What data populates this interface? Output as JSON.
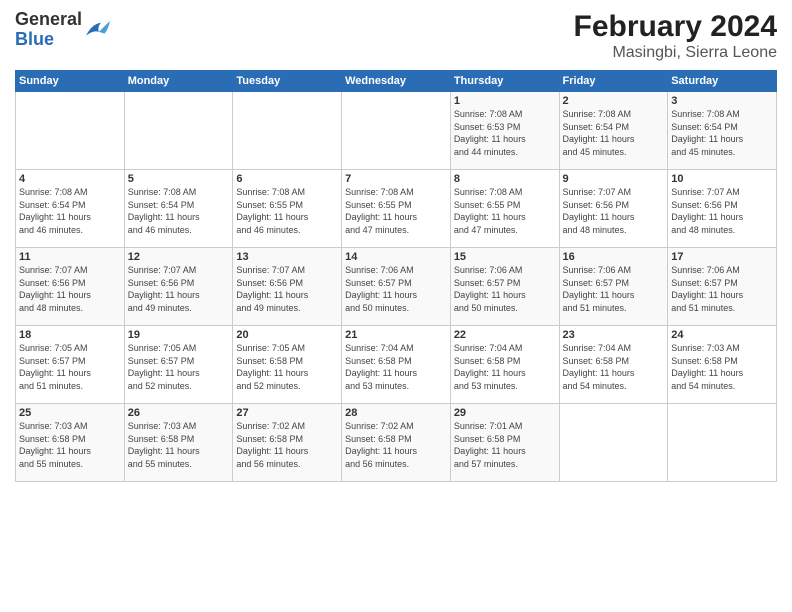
{
  "logo": {
    "general": "General",
    "blue": "Blue"
  },
  "title": "February 2024",
  "subtitle": "Masingbi, Sierra Leone",
  "headers": [
    "Sunday",
    "Monday",
    "Tuesday",
    "Wednesday",
    "Thursday",
    "Friday",
    "Saturday"
  ],
  "weeks": [
    [
      {
        "day": "",
        "info": ""
      },
      {
        "day": "",
        "info": ""
      },
      {
        "day": "",
        "info": ""
      },
      {
        "day": "",
        "info": ""
      },
      {
        "day": "1",
        "info": "Sunrise: 7:08 AM\nSunset: 6:53 PM\nDaylight: 11 hours\nand 44 minutes."
      },
      {
        "day": "2",
        "info": "Sunrise: 7:08 AM\nSunset: 6:54 PM\nDaylight: 11 hours\nand 45 minutes."
      },
      {
        "day": "3",
        "info": "Sunrise: 7:08 AM\nSunset: 6:54 PM\nDaylight: 11 hours\nand 45 minutes."
      }
    ],
    [
      {
        "day": "4",
        "info": "Sunrise: 7:08 AM\nSunset: 6:54 PM\nDaylight: 11 hours\nand 46 minutes."
      },
      {
        "day": "5",
        "info": "Sunrise: 7:08 AM\nSunset: 6:54 PM\nDaylight: 11 hours\nand 46 minutes."
      },
      {
        "day": "6",
        "info": "Sunrise: 7:08 AM\nSunset: 6:55 PM\nDaylight: 11 hours\nand 46 minutes."
      },
      {
        "day": "7",
        "info": "Sunrise: 7:08 AM\nSunset: 6:55 PM\nDaylight: 11 hours\nand 47 minutes."
      },
      {
        "day": "8",
        "info": "Sunrise: 7:08 AM\nSunset: 6:55 PM\nDaylight: 11 hours\nand 47 minutes."
      },
      {
        "day": "9",
        "info": "Sunrise: 7:07 AM\nSunset: 6:56 PM\nDaylight: 11 hours\nand 48 minutes."
      },
      {
        "day": "10",
        "info": "Sunrise: 7:07 AM\nSunset: 6:56 PM\nDaylight: 11 hours\nand 48 minutes."
      }
    ],
    [
      {
        "day": "11",
        "info": "Sunrise: 7:07 AM\nSunset: 6:56 PM\nDaylight: 11 hours\nand 48 minutes."
      },
      {
        "day": "12",
        "info": "Sunrise: 7:07 AM\nSunset: 6:56 PM\nDaylight: 11 hours\nand 49 minutes."
      },
      {
        "day": "13",
        "info": "Sunrise: 7:07 AM\nSunset: 6:56 PM\nDaylight: 11 hours\nand 49 minutes."
      },
      {
        "day": "14",
        "info": "Sunrise: 7:06 AM\nSunset: 6:57 PM\nDaylight: 11 hours\nand 50 minutes."
      },
      {
        "day": "15",
        "info": "Sunrise: 7:06 AM\nSunset: 6:57 PM\nDaylight: 11 hours\nand 50 minutes."
      },
      {
        "day": "16",
        "info": "Sunrise: 7:06 AM\nSunset: 6:57 PM\nDaylight: 11 hours\nand 51 minutes."
      },
      {
        "day": "17",
        "info": "Sunrise: 7:06 AM\nSunset: 6:57 PM\nDaylight: 11 hours\nand 51 minutes."
      }
    ],
    [
      {
        "day": "18",
        "info": "Sunrise: 7:05 AM\nSunset: 6:57 PM\nDaylight: 11 hours\nand 51 minutes."
      },
      {
        "day": "19",
        "info": "Sunrise: 7:05 AM\nSunset: 6:57 PM\nDaylight: 11 hours\nand 52 minutes."
      },
      {
        "day": "20",
        "info": "Sunrise: 7:05 AM\nSunset: 6:58 PM\nDaylight: 11 hours\nand 52 minutes."
      },
      {
        "day": "21",
        "info": "Sunrise: 7:04 AM\nSunset: 6:58 PM\nDaylight: 11 hours\nand 53 minutes."
      },
      {
        "day": "22",
        "info": "Sunrise: 7:04 AM\nSunset: 6:58 PM\nDaylight: 11 hours\nand 53 minutes."
      },
      {
        "day": "23",
        "info": "Sunrise: 7:04 AM\nSunset: 6:58 PM\nDaylight: 11 hours\nand 54 minutes."
      },
      {
        "day": "24",
        "info": "Sunrise: 7:03 AM\nSunset: 6:58 PM\nDaylight: 11 hours\nand 54 minutes."
      }
    ],
    [
      {
        "day": "25",
        "info": "Sunrise: 7:03 AM\nSunset: 6:58 PM\nDaylight: 11 hours\nand 55 minutes."
      },
      {
        "day": "26",
        "info": "Sunrise: 7:03 AM\nSunset: 6:58 PM\nDaylight: 11 hours\nand 55 minutes."
      },
      {
        "day": "27",
        "info": "Sunrise: 7:02 AM\nSunset: 6:58 PM\nDaylight: 11 hours\nand 56 minutes."
      },
      {
        "day": "28",
        "info": "Sunrise: 7:02 AM\nSunset: 6:58 PM\nDaylight: 11 hours\nand 56 minutes."
      },
      {
        "day": "29",
        "info": "Sunrise: 7:01 AM\nSunset: 6:58 PM\nDaylight: 11 hours\nand 57 minutes."
      },
      {
        "day": "",
        "info": ""
      },
      {
        "day": "",
        "info": ""
      }
    ]
  ]
}
